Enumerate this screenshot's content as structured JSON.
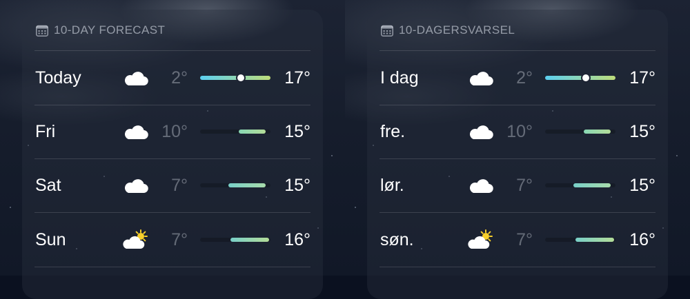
{
  "panels": [
    {
      "header": {
        "title": "10-DAY FORECAST",
        "icon": "calendar-icon"
      },
      "days": [
        {
          "label": "Today",
          "icon": "cloud-icon",
          "low": "2°",
          "high": "17°",
          "bar_start": 0.0,
          "bar_end": 1.0,
          "current": 0.58,
          "bar_colors": [
            "#5ccff0",
            "#bddc7a"
          ]
        },
        {
          "label": "Fri",
          "icon": "cloud-icon",
          "low": "10°",
          "high": "15°",
          "bar_start": 0.55,
          "bar_end": 0.93,
          "bar_colors": [
            "#88d7b4",
            "#b3dc98"
          ]
        },
        {
          "label": "Sat",
          "icon": "cloud-icon",
          "low": "7°",
          "high": "15°",
          "bar_start": 0.4,
          "bar_end": 0.93,
          "bar_colors": [
            "#78cfc8",
            "#a8dcab"
          ]
        },
        {
          "label": "Sun",
          "icon": "partly-sunny-icon",
          "low": "7°",
          "high": "16°",
          "bar_start": 0.43,
          "bar_end": 0.98,
          "bar_colors": [
            "#78cfc8",
            "#b3dc98"
          ]
        }
      ]
    },
    {
      "header": {
        "title": "10-DAGERSVARSEL",
        "icon": "calendar-icon"
      },
      "days": [
        {
          "label": "I dag",
          "icon": "cloud-icon",
          "low": "2°",
          "high": "17°",
          "bar_start": 0.0,
          "bar_end": 1.0,
          "current": 0.58,
          "bar_colors": [
            "#5ccff0",
            "#bddc7a"
          ]
        },
        {
          "label": "fre.",
          "icon": "cloud-icon",
          "low": "10°",
          "high": "15°",
          "bar_start": 0.55,
          "bar_end": 0.93,
          "bar_colors": [
            "#88d7b4",
            "#b3dc98"
          ]
        },
        {
          "label": "lør.",
          "icon": "cloud-icon",
          "low": "7°",
          "high": "15°",
          "bar_start": 0.4,
          "bar_end": 0.93,
          "bar_colors": [
            "#78cfc8",
            "#a8dcab"
          ]
        },
        {
          "label": "søn.",
          "icon": "partly-sunny-icon",
          "low": "7°",
          "high": "16°",
          "bar_start": 0.43,
          "bar_end": 0.98,
          "bar_colors": [
            "#78cfc8",
            "#b3dc98"
          ]
        }
      ]
    }
  ]
}
